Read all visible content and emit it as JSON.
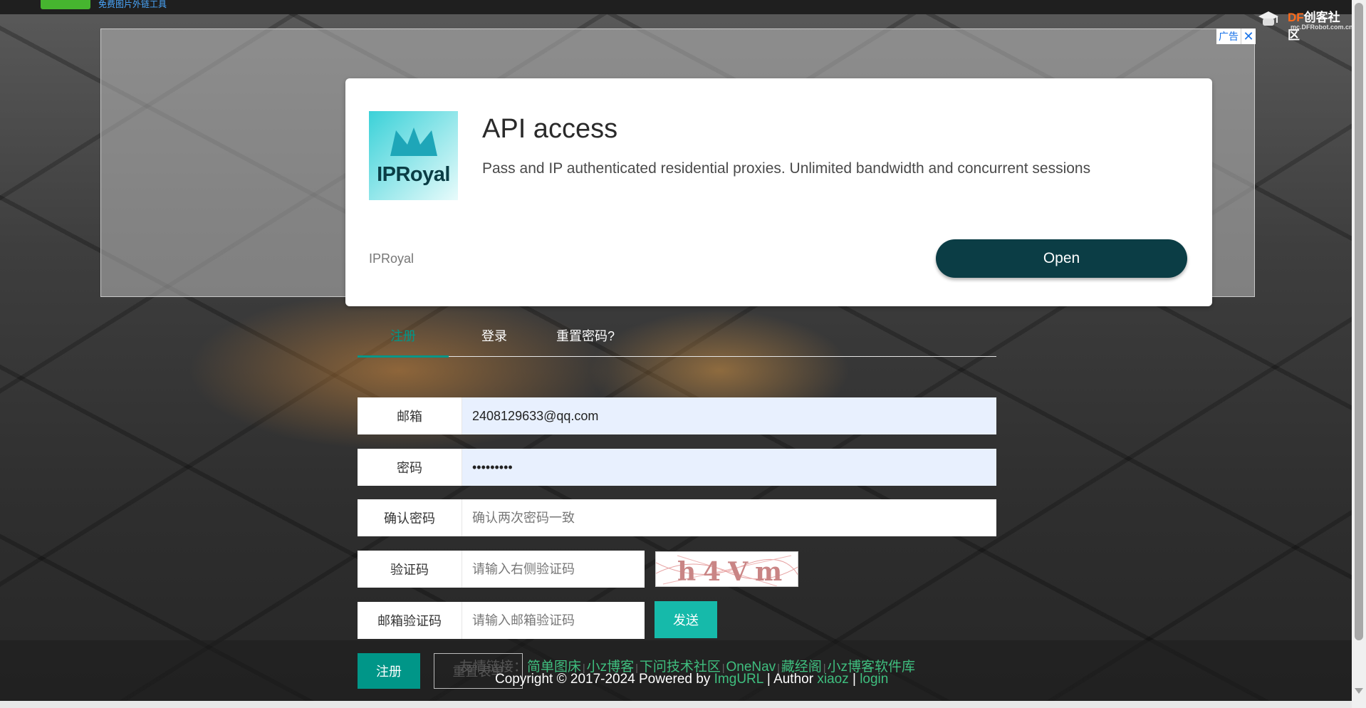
{
  "header": {
    "site_tagline": "免费图片外链工具",
    "community_logo": {
      "brand_a": "DF",
      "brand_b": "创客社区",
      "domain": "mc.DFRobot.com.cn"
    }
  },
  "ad": {
    "badge_label": "广告",
    "close_icon": "close-icon",
    "logo_text": "IPRoyal",
    "title": "API access",
    "description": "Pass and IP authenticated residential proxies. Unlimited bandwidth and concurrent sessions",
    "advertiser": "IPRoyal",
    "cta": "Open",
    "cta_color": "#0b3d45"
  },
  "tabs": [
    {
      "label": "注册",
      "active": true
    },
    {
      "label": "登录",
      "active": false
    },
    {
      "label": "重置密码?",
      "active": false
    }
  ],
  "form": {
    "email": {
      "label": "邮箱",
      "value": "2408129633@qq.com"
    },
    "password": {
      "label": "密码",
      "value": "•••••••••"
    },
    "confirm": {
      "label": "确认密码",
      "placeholder": "确认两次密码一致"
    },
    "captcha": {
      "label": "验证码",
      "placeholder": "请输入右侧验证码",
      "image_text": "h4Vm"
    },
    "email_code": {
      "label": "邮箱验证码",
      "placeholder": "请输入邮箱验证码",
      "send_label": "发送"
    },
    "submit_label": "注册",
    "reset_label": "重置表单"
  },
  "footer": {
    "friend_links_label": "友情链接：",
    "friend_links": [
      "简单图床",
      "小z博客",
      "下问技术社区",
      "OneNav",
      "藏经阁",
      "小z博客软件库"
    ],
    "copyright_prefix": "Copyright © 2017-2024 Powered by",
    "powered_by": "ImgURL",
    "author_label": "| Author",
    "author": "xiaoz",
    "sep": "|",
    "login": "login"
  },
  "colors": {
    "accent": "#009688",
    "send_button": "#16baaa",
    "link": "#3fbf7f"
  }
}
